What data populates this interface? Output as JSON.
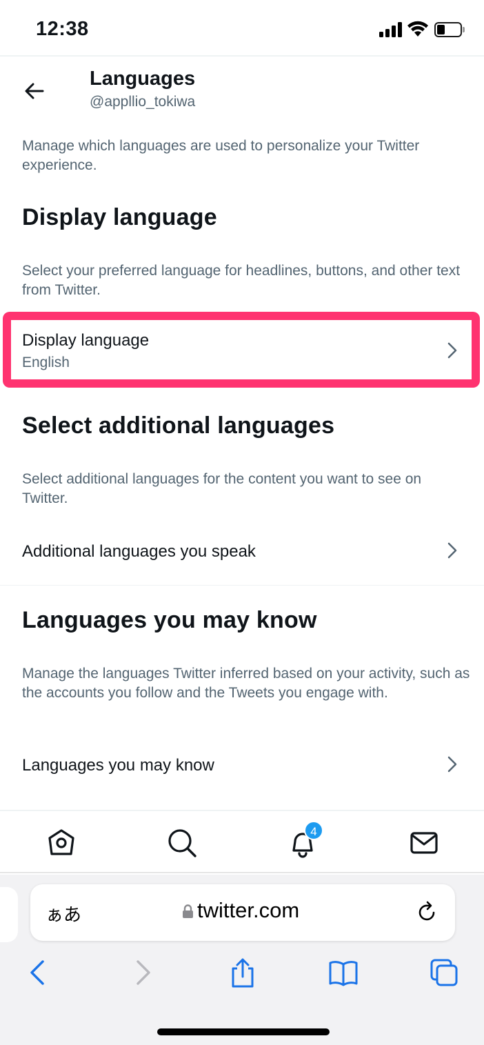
{
  "status_bar": {
    "time": "12:38"
  },
  "header": {
    "title": "Languages",
    "handle": "@appllio_tokiwa"
  },
  "intro": "Manage which languages are used to personalize your Twitter experience.",
  "display_section": {
    "heading": "Display language",
    "description": "Select your preferred language for headlines, buttons, and other text from Twitter.",
    "row_label": "Display language",
    "row_value": "English"
  },
  "additional_section": {
    "heading": "Select additional languages",
    "description": "Select additional languages for the content you want to see on Twitter.",
    "row_label": "Additional languages you speak"
  },
  "may_know_section": {
    "heading": "Languages you may know",
    "description": "Manage the languages Twitter inferred based on your activity, such as the accounts you follow and the Tweets you engage with.",
    "row_label": "Languages you may know"
  },
  "tabbar": {
    "notifications_badge": "4",
    "icons": [
      "home-icon",
      "search-icon",
      "notifications-icon",
      "messages-icon"
    ]
  },
  "safari": {
    "aa_label": "ぁあ",
    "url": "twitter.com"
  },
  "colors": {
    "highlight": "#ff3370",
    "accent": "#1d9bf0",
    "safari_blue": "#1a73e8",
    "secondary_text": "#536471"
  }
}
